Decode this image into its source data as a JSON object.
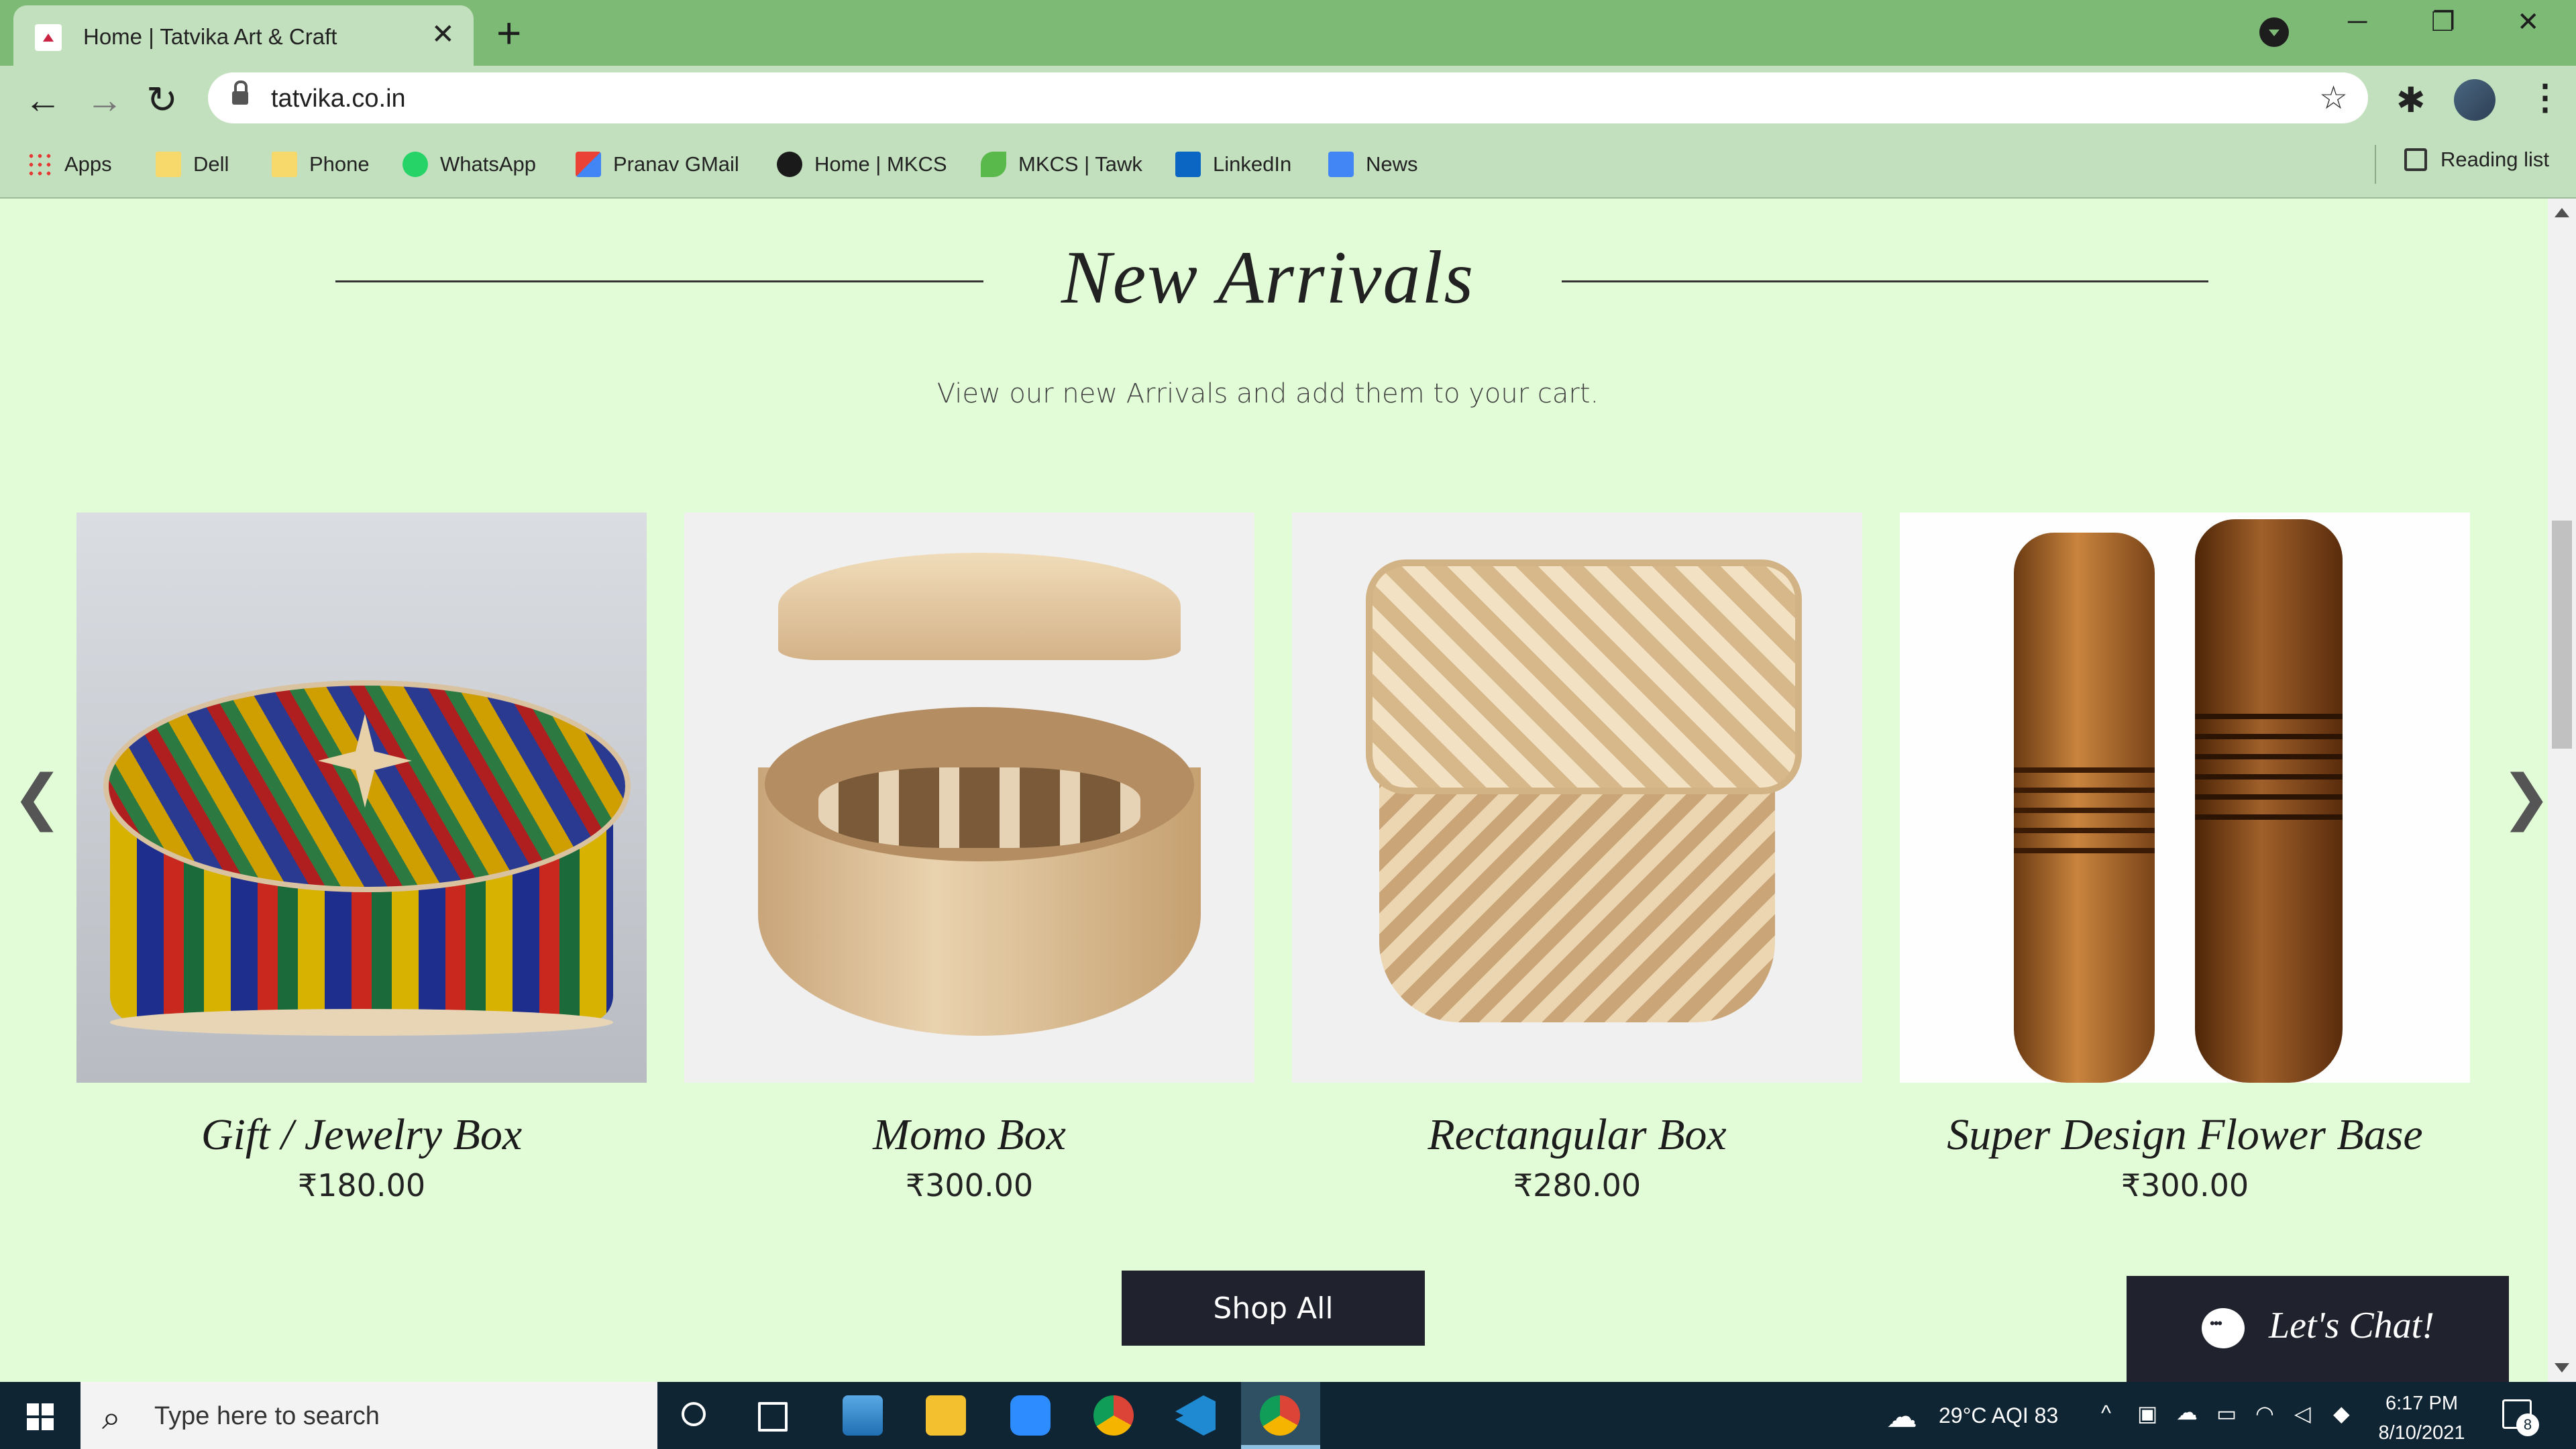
{
  "browser": {
    "tab_title": "Home | Tatvika Art & Craft",
    "tab_close": "✕",
    "new_tab": "+",
    "url": "tatvika.co.in",
    "bookmarks": [
      {
        "label": "Apps",
        "icon": "apps-grid-icon"
      },
      {
        "label": "Dell",
        "icon": "folder-icon"
      },
      {
        "label": "Phone",
        "icon": "folder-icon"
      },
      {
        "label": "WhatsApp",
        "icon": "whatsapp-icon"
      },
      {
        "label": "Pranav GMail",
        "icon": "gmail-icon"
      },
      {
        "label": "Home | MKCS",
        "icon": "mkcs-icon"
      },
      {
        "label": "MKCS | Tawk",
        "icon": "tawk-icon"
      },
      {
        "label": "LinkedIn",
        "icon": "linkedin-icon"
      },
      {
        "label": "News",
        "icon": "google-news-icon"
      }
    ],
    "reading_list": "Reading list"
  },
  "page": {
    "heading": "New Arrivals",
    "subheading": "View our new Arrivals and add them to your cart.",
    "products": [
      {
        "name": "Gift / Jewelry Box",
        "price": "₹180.00"
      },
      {
        "name": "Momo Box",
        "price": "₹300.00"
      },
      {
        "name": "Rectangular Box",
        "price": "₹280.00"
      },
      {
        "name": "Super Design Flower Base",
        "price": "₹300.00"
      }
    ],
    "prev_arrow": "❮",
    "next_arrow": "❯",
    "shop_all": "Shop All",
    "chat_label": "Let's Chat!"
  },
  "taskbar": {
    "search_placeholder": "Type here to search",
    "weather": "29°C  AQI 83",
    "time": "6:17 PM",
    "date": "8/10/2021",
    "notification_count": "8"
  },
  "colors": {
    "page_bg": "#e1fcd6",
    "tabstrip": "#7dba76",
    "toolbar": "#c2e0bd",
    "button_dark": "#20232d",
    "taskbar": "#0f2533"
  }
}
